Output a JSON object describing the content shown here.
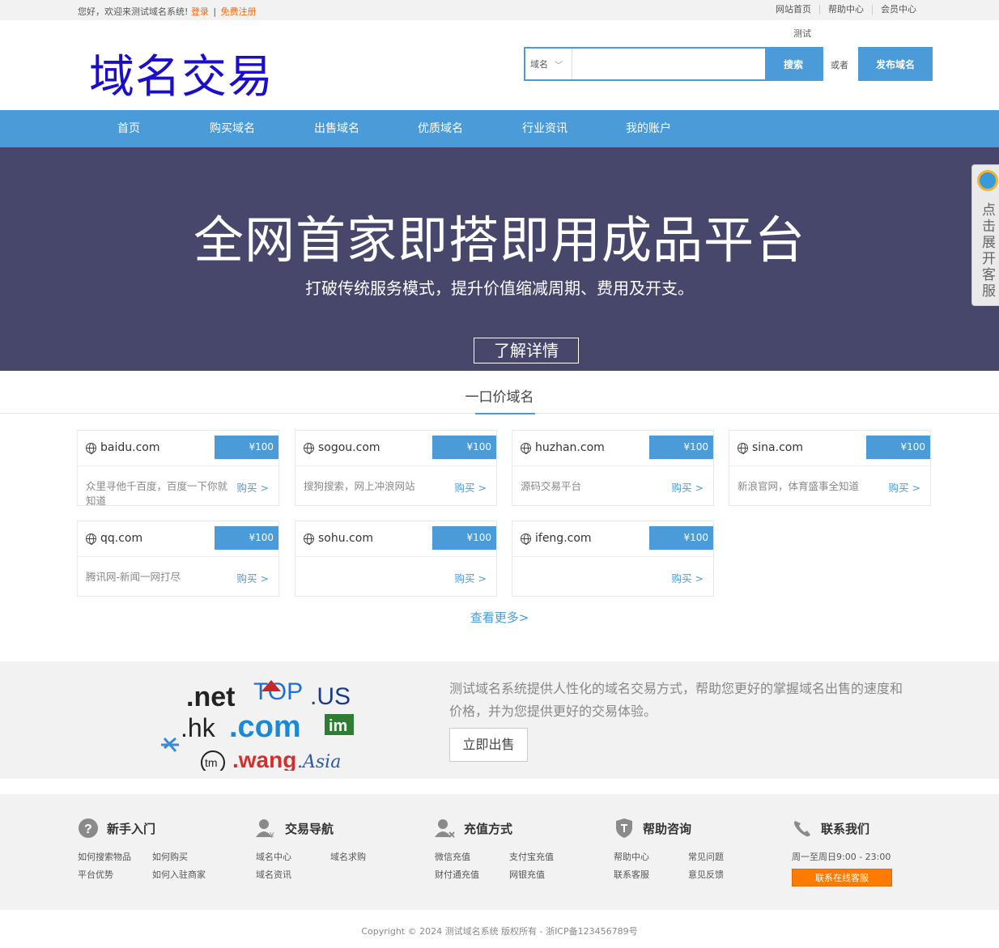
{
  "topbar": {
    "welcome": "您好，欢迎来测试域名系统!",
    "login": "登录",
    "sep": "|",
    "register": "免费注册",
    "links": [
      "网站首页",
      "帮助中心",
      "会员中心"
    ]
  },
  "header": {
    "logo": "域名交易",
    "test_label": "测试",
    "search_select": "域名",
    "search_value": "",
    "search_button": "搜索",
    "or_label": "或者",
    "publish_button": "发布域名"
  },
  "nav": [
    "首页",
    "购买域名",
    "出售域名",
    "优质域名",
    "行业资讯",
    "我的账户"
  ],
  "banner": {
    "title": "全网首家即搭即用成品平台",
    "subtitle": "打破传统服务模式，提升价值缩减周期、费用及开支。",
    "button": "了解详情"
  },
  "side_service": "点击展开客服",
  "section": {
    "title": "一口价域名",
    "view_more": "查看更多>"
  },
  "domains": [
    {
      "name": "baidu.com",
      "price": "¥100",
      "desc": "众里寻他千百度，百度一下你就知道",
      "buy": "购买 >"
    },
    {
      "name": "sogou.com",
      "price": "¥100",
      "desc": "搜狗搜索，网上冲浪网站",
      "buy": "购买 >"
    },
    {
      "name": "huzhan.com",
      "price": "¥100",
      "desc": "源码交易平台",
      "buy": "购买 >"
    },
    {
      "name": "sina.com",
      "price": "¥100",
      "desc": "新浪官网，体育盛事全知道",
      "buy": "购买 >"
    },
    {
      "name": "qq.com",
      "price": "¥100",
      "desc": "腾讯网-新闻一网打尽",
      "buy": "购买 >"
    },
    {
      "name": "sohu.com",
      "price": "¥100",
      "desc": "",
      "buy": "购买 >"
    },
    {
      "name": "ifeng.com",
      "price": "¥100",
      "desc": "",
      "buy": "购买 >"
    }
  ],
  "promo": {
    "text": "测试域名系统提供人性化的域名交易方式，帮助您更好的掌握域名出售的速度和价格，并为您提供更好的交易体验。",
    "button": "立即出售",
    "logo_words": [
      ".net",
      "TOP",
      ".US",
      ".hk",
      ".com",
      "im",
      "tm",
      ".wang",
      ".Asia"
    ]
  },
  "footer": {
    "columns": [
      {
        "title": "新手入门",
        "icon": "question-icon",
        "links": [
          "如何搜索物品",
          "如何购买",
          "平台优势",
          "如何入驻商家"
        ]
      },
      {
        "title": "交易导航",
        "icon": "user-yen-icon",
        "links": [
          "域名中心",
          "域名求购",
          "域名资讯"
        ]
      },
      {
        "title": "充值方式",
        "icon": "user-pay-icon",
        "links": [
          "微信充值",
          "支付宝充值",
          "财付通充值",
          "网银充值"
        ]
      },
      {
        "title": "帮助咨询",
        "icon": "shield-icon",
        "links": [
          "帮助中心",
          "常见问题",
          "联系客服",
          "意见反馈"
        ]
      },
      {
        "title": "联系我们",
        "icon": "phone-icon",
        "hours": "周一至周日9:00 - 23:00",
        "button": "联系在线客服"
      }
    ],
    "copyright": "Copyright © 2024 测试域名系统 版权所有 - 浙ICP备123456789号"
  },
  "colors": {
    "accent": "#4a9bd8",
    "banner_bg": "#47476b",
    "orange": "#ff7a00",
    "logo_blue": "#1a0dcc"
  }
}
